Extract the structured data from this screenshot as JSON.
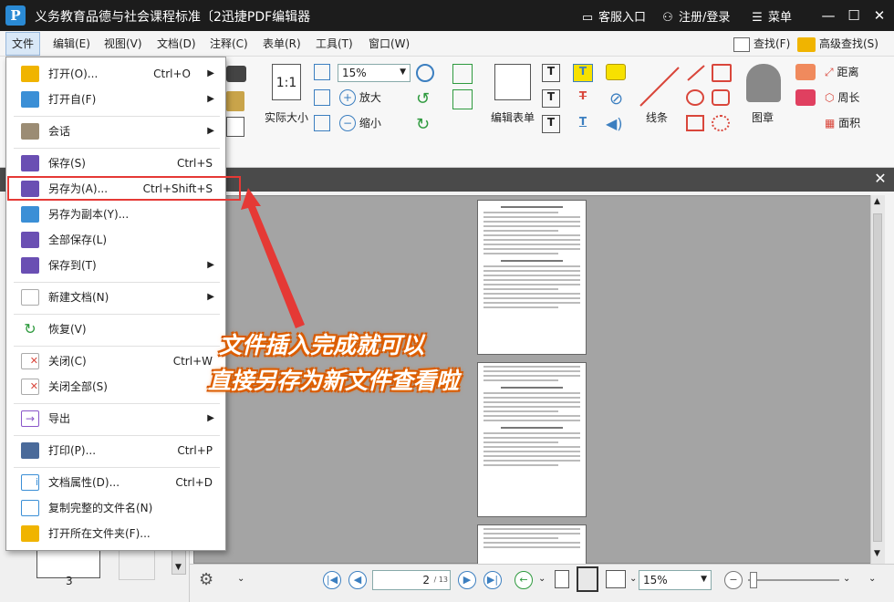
{
  "titlebar": {
    "logo": "P",
    "title": "义务教育品德与社会课程标准〔2迅捷PDF编辑器",
    "service": "客服入口",
    "login": "注册/登录",
    "menu": "菜单"
  },
  "menubar": {
    "items": [
      "文件",
      "编辑(E)",
      "视图(V)",
      "文档(D)",
      "注释(C)",
      "表单(R)",
      "工具(T)",
      "窗口(W)"
    ],
    "find": "查找(F)",
    "advanced_find": "高级查找(S)"
  },
  "toolbar": {
    "zoom_value": "15%",
    "actual_size": "实际大小",
    "zoom_in": "放大",
    "zoom_out": "缩小",
    "edit_form": "编辑表单",
    "line_tool": "线条",
    "stamp": "图章",
    "distance": "距离",
    "perimeter": "周长",
    "area": "面积"
  },
  "file_menu": {
    "items": [
      {
        "label": "打开(O)...",
        "shortcut": "Ctrl+O",
        "submenu": true,
        "color": "#f0b400"
      },
      {
        "label": "打开自(F)",
        "shortcut": "",
        "submenu": true,
        "color": "#3b8fd6"
      },
      {
        "label": "会话",
        "shortcut": "",
        "submenu": true,
        "color": "#9b8c74"
      },
      {
        "label": "保存(S)",
        "shortcut": "Ctrl+S",
        "submenu": false,
        "color": "#6a4fb3"
      },
      {
        "label": "另存为(A)...",
        "shortcut": "Ctrl+Shift+S",
        "submenu": false,
        "color": "#6a4fb3"
      },
      {
        "label": "另存为副本(Y)...",
        "shortcut": "",
        "submenu": false,
        "color": "#3b8fd6"
      },
      {
        "label": "全部保存(L)",
        "shortcut": "",
        "submenu": false,
        "color": "#6a4fb3"
      },
      {
        "label": "保存到(T)",
        "shortcut": "",
        "submenu": true,
        "color": "#6a4fb3"
      },
      {
        "label": "新建文档(N)",
        "shortcut": "",
        "submenu": true,
        "color": "#f0c800"
      },
      {
        "label": "恢复(V)",
        "shortcut": "",
        "submenu": false,
        "color": "#2e9a3e"
      },
      {
        "label": "关闭(C)",
        "shortcut": "Ctrl+W",
        "submenu": false,
        "color": "#d9463b"
      },
      {
        "label": "关闭全部(S)",
        "shortcut": "",
        "submenu": false,
        "color": "#d9463b"
      },
      {
        "label": "导出",
        "shortcut": "",
        "submenu": true,
        "color": "#8a56c9"
      },
      {
        "label": "打印(P)...",
        "shortcut": "Ctrl+P",
        "submenu": false,
        "color": "#4a6a9a"
      },
      {
        "label": "文档属性(D)...",
        "shortcut": "Ctrl+D",
        "submenu": false,
        "color": "#3b8fd6"
      },
      {
        "label": "复制完整的文件名(N)",
        "shortcut": "",
        "submenu": false,
        "color": "#3b8fd6"
      },
      {
        "label": "打开所在文件夹(F)...",
        "shortcut": "",
        "submenu": false,
        "color": "#f0b400"
      }
    ]
  },
  "annotation": {
    "line1": "文件插入完成就可以",
    "line2": "直接另存为新文件查看啦"
  },
  "thumbnail": {
    "page_label": "3"
  },
  "statusbar": {
    "page_current": "2",
    "page_total": "/ 13",
    "zoom": "15%"
  }
}
